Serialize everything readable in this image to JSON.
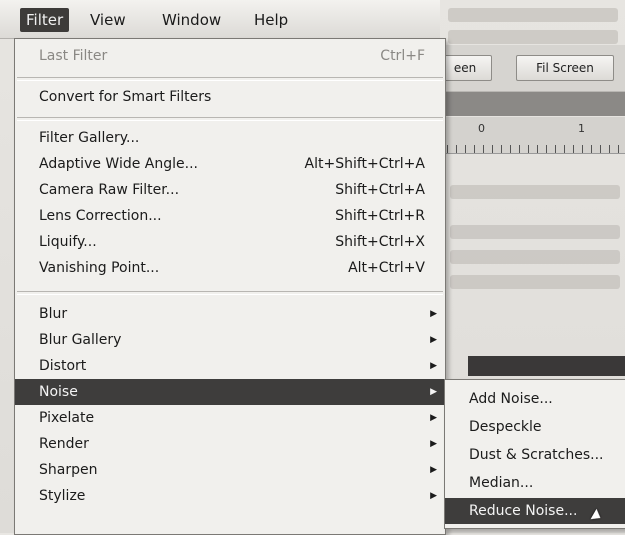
{
  "menubar": {
    "items": [
      {
        "label": "Filter",
        "active": true
      },
      {
        "label": "View"
      },
      {
        "label": "Window"
      },
      {
        "label": "Help"
      }
    ]
  },
  "toolbar": {
    "screen_label": "een",
    "fill_screen_label": "Fil Screen"
  },
  "ruler": {
    "labels": [
      "0",
      "1"
    ]
  },
  "filter_menu": {
    "last_filter": {
      "label": "Last Filter",
      "shortcut": "Ctrl+F"
    },
    "convert": {
      "label": "Convert for Smart Filters"
    },
    "filter_gallery": {
      "label": "Filter Gallery..."
    },
    "adaptive_wide_angle": {
      "label": "Adaptive Wide Angle...",
      "shortcut": "Alt+Shift+Ctrl+A"
    },
    "camera_raw": {
      "label": "Camera Raw Filter...",
      "shortcut": "Shift+Ctrl+A"
    },
    "lens_correction": {
      "label": "Lens Correction...",
      "shortcut": "Shift+Ctrl+R"
    },
    "liquify": {
      "label": "Liquify...",
      "shortcut": "Shift+Ctrl+X"
    },
    "vanishing_point": {
      "label": "Vanishing Point...",
      "shortcut": "Alt+Ctrl+V"
    },
    "blur": {
      "label": "Blur"
    },
    "blur_gallery": {
      "label": "Blur Gallery"
    },
    "distort": {
      "label": "Distort"
    },
    "noise": {
      "label": "Noise"
    },
    "pixelate": {
      "label": "Pixelate"
    },
    "render": {
      "label": "Render"
    },
    "sharpen": {
      "label": "Sharpen"
    },
    "stylize": {
      "label": "Stylize"
    }
  },
  "noise_submenu": {
    "add_noise": "Add Noise...",
    "despeckle": "Despeckle",
    "dust_scratches": "Dust & Scratches...",
    "median": "Median...",
    "reduce_noise": "Reduce Noise..."
  },
  "icons": {
    "submenu_arrow": "triangle-right-icon",
    "cursor": "mouse-pointer-icon"
  },
  "colors": {
    "highlight": "#3e3d3c",
    "menu_bg": "#f1f0ed"
  }
}
